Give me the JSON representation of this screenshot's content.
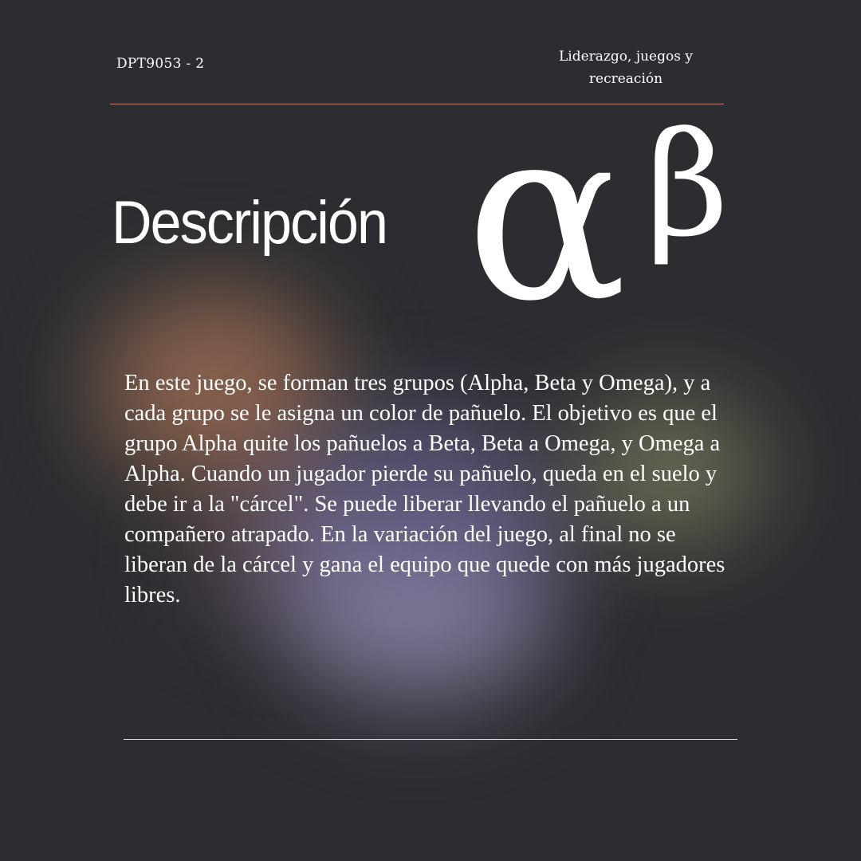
{
  "header": {
    "code": "DPT9053 - 2",
    "course": "Liderazgo, juegos y recreación"
  },
  "title": "Descripción",
  "symbols": {
    "alpha": "α",
    "beta": "β"
  },
  "description": "En este juego, se forman tres grupos (Alpha, Beta y Omega), y a cada grupo se le asigna un color de pañuelo. El objetivo es que el grupo Alpha quite los pañuelos a Beta, Beta a Omega, y Omega a Alpha. Cuando un jugador pierde su pañuelo, queda en el suelo y debe ir a la \"cárcel\". Se puede liberar llevando el pañuelo a un compañero atrapado. En la variación del juego, al final no se liberan de la cárcel y gana el equipo que quede con más jugadores libres.",
  "colors": {
    "background": "#2b2d31",
    "top_rule": "#c9877c",
    "bottom_rule": "#d8d8d8",
    "text": "#ffffff"
  }
}
